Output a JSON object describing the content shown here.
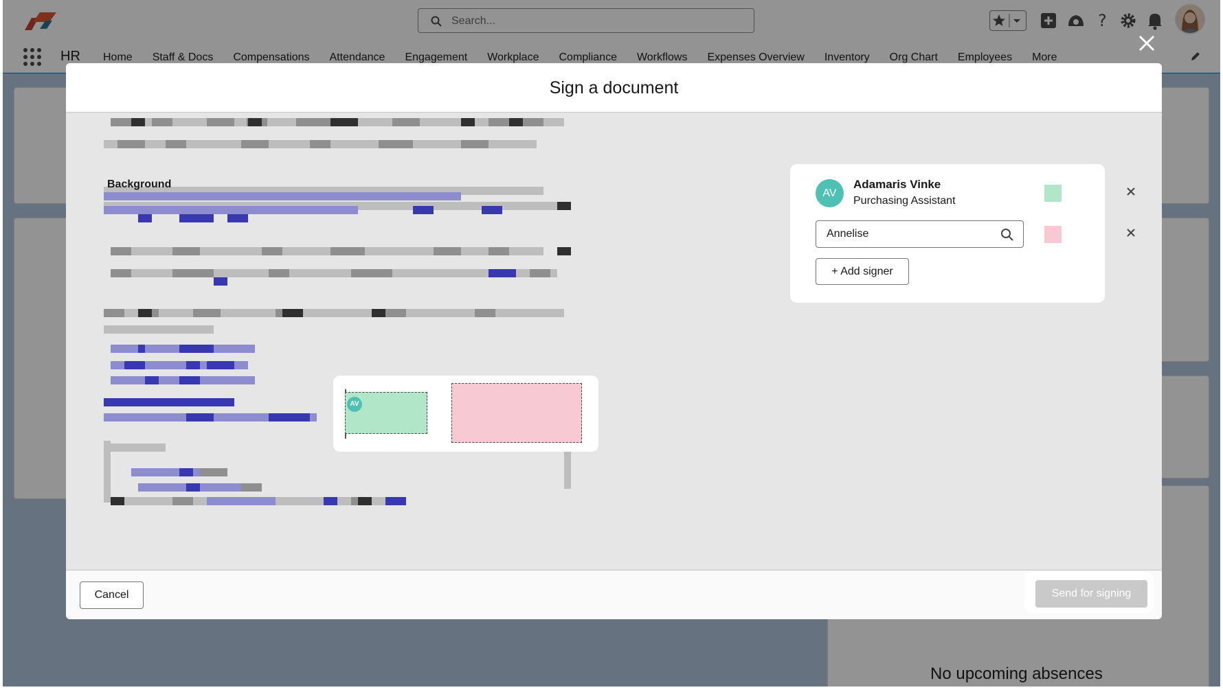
{
  "topbar": {
    "search_placeholder": "Search..."
  },
  "nav": {
    "app_name": "HR",
    "items": [
      "Home",
      "Staff & Docs",
      "Compensations",
      "Attendance",
      "Engagement",
      "Workplace",
      "Compliance",
      "Workflows",
      "Expenses Overview",
      "Inventory",
      "Org Chart",
      "Employees",
      "More"
    ]
  },
  "background_page": {
    "absence_text": "No upcoming absences"
  },
  "modal": {
    "title": "Sign a document",
    "document_heading": "Background",
    "signature_field_initials": "AV",
    "cancel_label": "Cancel",
    "send_label": "Send for signing"
  },
  "signers": {
    "first": {
      "initials": "AV",
      "name": "Adamaris Vinke",
      "role": "Purchasing Assistant",
      "color": "#b2e6c9"
    },
    "second": {
      "input_value": "Annelise",
      "color": "#f7c9d3"
    },
    "add_label": "+ Add signer"
  }
}
